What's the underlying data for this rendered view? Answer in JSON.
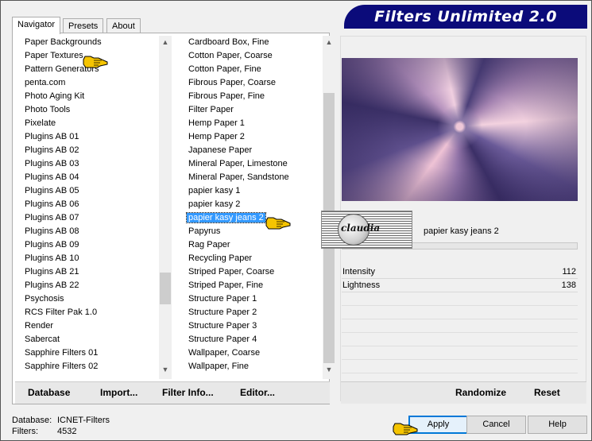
{
  "window": {
    "title": "Filters Unlimited 2.0"
  },
  "tabs": [
    {
      "label": "Navigator",
      "active": true
    },
    {
      "label": "Presets",
      "active": false
    },
    {
      "label": "About",
      "active": false
    }
  ],
  "category_list": {
    "items": [
      "Paper Backgrounds",
      "Paper Textures",
      "Pattern Generators",
      "penta.com",
      "Photo Aging Kit",
      "Photo Tools",
      "Pixelate",
      "Plugins AB 01",
      "Plugins AB 02",
      "Plugins AB 03",
      "Plugins AB 04",
      "Plugins AB 05",
      "Plugins AB 06",
      "Plugins AB 07",
      "Plugins AB 08",
      "Plugins AB 09",
      "Plugins AB 10",
      "Plugins AB 21",
      "Plugins AB 22",
      "Psychosis",
      "RCS Filter Pak 1.0",
      "Render",
      "Sabercat",
      "Sapphire Filters 01",
      "Sapphire Filters 02"
    ],
    "pointed_item": "Paper Textures"
  },
  "filter_list": {
    "items": [
      "Cardboard Box, Fine",
      "Cotton Paper, Coarse",
      "Cotton Paper, Fine",
      "Fibrous Paper, Coarse",
      "Fibrous Paper, Fine",
      "Filter Paper",
      "Hemp Paper 1",
      "Hemp Paper 2",
      "Japanese Paper",
      "Mineral Paper, Limestone",
      "Mineral Paper, Sandstone",
      "papier kasy 1",
      "papier kasy 2",
      "papier kasy jeans 2",
      "Papyrus",
      "Rag Paper",
      "Recycling Paper",
      "Striped Paper, Coarse",
      "Striped Paper, Fine",
      "Structure Paper 1",
      "Structure Paper 2",
      "Structure Paper 3",
      "Structure Paper 4",
      "Wallpaper, Coarse",
      "Wallpaper, Fine"
    ],
    "selected": "papier kasy jeans 2"
  },
  "preview": {
    "filter_name": "papier kasy jeans 2",
    "params": [
      {
        "label": "Intensity",
        "value": "112"
      },
      {
        "label": "Lightness",
        "value": "138"
      }
    ],
    "watermark_text": "claudia"
  },
  "left_buttons": {
    "database": "Database",
    "import": "Import...",
    "filter_info": "Filter Info...",
    "editor": "Editor..."
  },
  "right_buttons": {
    "randomize": "Randomize",
    "reset": "Reset"
  },
  "status": {
    "database_label": "Database:",
    "database_value": "ICNET-Filters",
    "filters_label": "Filters:",
    "filters_value": "4532"
  },
  "dialog_buttons": {
    "apply": "Apply",
    "cancel": "Cancel",
    "help": "Help"
  },
  "colors": {
    "banner_bg": "#0b0b7a",
    "selection": "#3399ff",
    "hand_cursor": "#f5c400"
  }
}
